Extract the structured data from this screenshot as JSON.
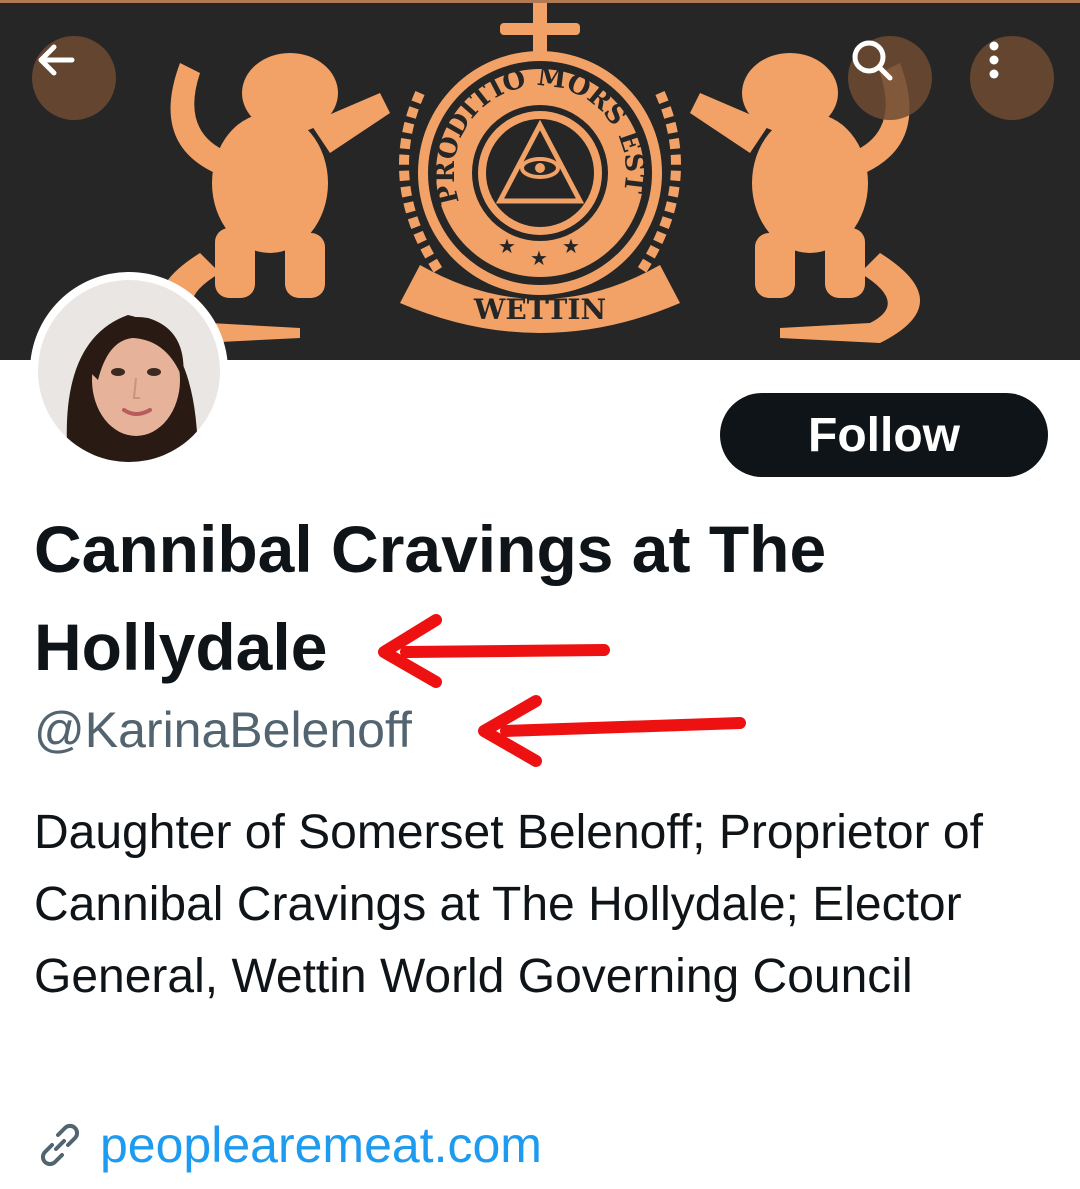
{
  "header": {
    "back_icon": "arrow-left-icon",
    "search_icon": "search-icon",
    "more_icon": "more-vertical-icon"
  },
  "banner": {
    "motto": "PRODITIO MORS EST",
    "scroll_text": "WETTIN",
    "background_color": "#262626",
    "crest_color": "#f2a267"
  },
  "profile": {
    "follow_label": "Follow",
    "display_name": "Cannibal Cravings at The Hollydale",
    "handle": "@KarinaBelenoff",
    "bio": "Daughter of Somerset Belenoff; Proprietor of Cannibal Cravings at The Hollydale; Elector General, Wettin World Governing Council",
    "website": "peoplearemeat.com",
    "link_icon": "link-icon"
  },
  "colors": {
    "accent_link": "#1d9bf0",
    "secondary_text": "#536471",
    "annotation_arrow": "#ee1111"
  }
}
